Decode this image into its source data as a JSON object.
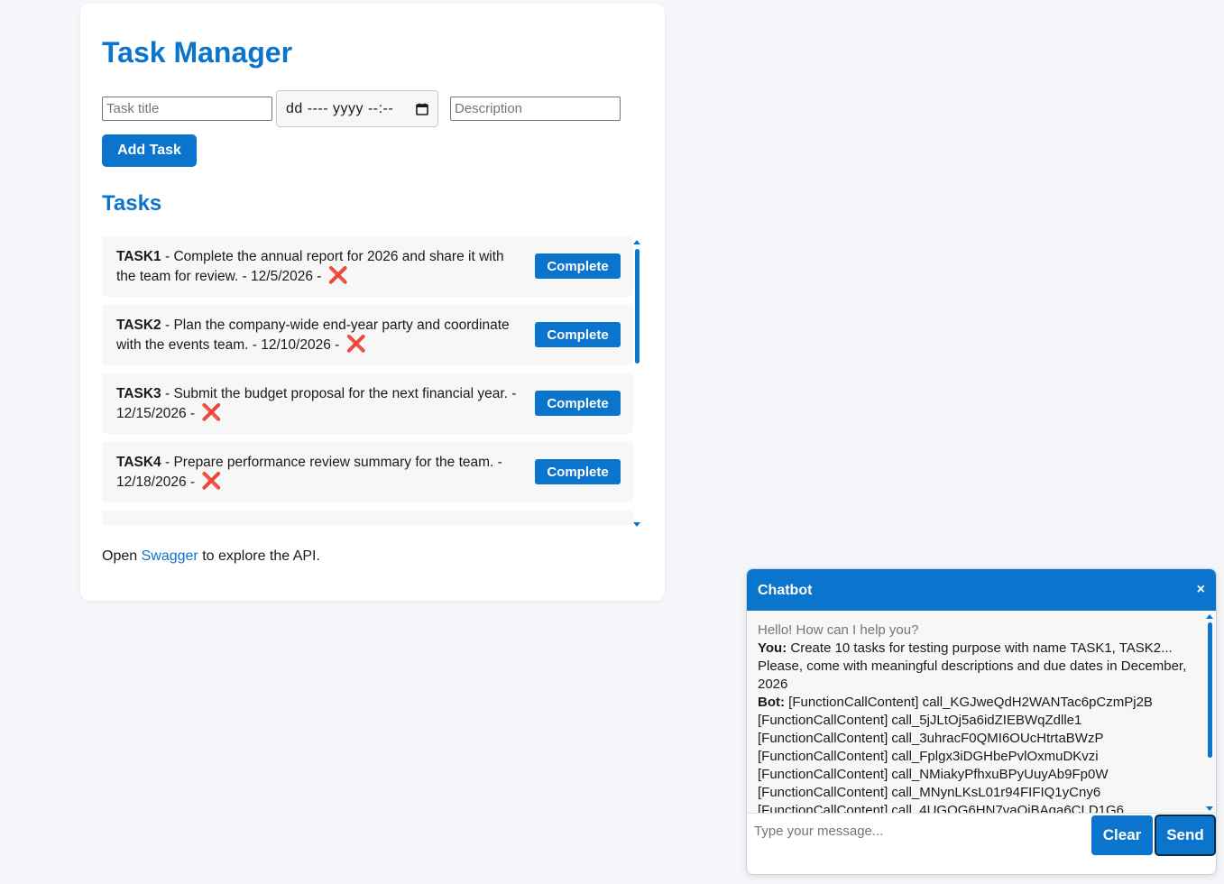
{
  "app": {
    "title": "Task Manager",
    "tasks_heading": "Tasks"
  },
  "form": {
    "title_placeholder": "Task title",
    "date_value": "dd ---- yyyy --:--",
    "description_placeholder": "Description",
    "add_button": "Add Task",
    "calendar_icon": "calendar-icon"
  },
  "tasks": [
    {
      "name": "TASK1",
      "line1": " - Complete the annual report for 2026 and share it with",
      "line2": "the team for review. - 12/5/2026 - ",
      "status_icon": "❌",
      "button": "Complete"
    },
    {
      "name": "TASK2",
      "line1": " - Plan the company-wide end-year party and coordinate",
      "line2": "with the events team. - 12/10/2026 - ",
      "status_icon": "❌",
      "button": "Complete"
    },
    {
      "name": "TASK3",
      "line1": " - Submit the budget proposal for the next financial year. -",
      "line2": "12/15/2026 - ",
      "status_icon": "❌",
      "button": "Complete"
    },
    {
      "name": "TASK4",
      "line1": " - Prepare performance review summary for the team. -",
      "line2": "12/18/2026 - ",
      "status_icon": "❌",
      "button": "Complete"
    }
  ],
  "footer": {
    "prefix": "Open ",
    "link": "Swagger",
    "suffix": " to explore the API."
  },
  "chatbot": {
    "title": "Chatbot",
    "close": "×",
    "greeting": "Hello! How can I help you?",
    "user_label": "You:",
    "user_message": " Create 10 tasks for testing purpose with name TASK1, TASK2... Please, come with meaningful descriptions and due dates in December, 2026",
    "bot_label": "Bot:",
    "bot_lines": [
      " [FunctionCallContent] call_KGJweQdH2WANTac6pCzmPj2B",
      "[FunctionCallContent] call_5jJLtOj5a6idZIEBWqZdlle1",
      "[FunctionCallContent] call_3uhracF0QMI6OUcHtrtaBWzP",
      "[FunctionCallContent] call_Fplgx3iDGHbePvlOxmuDKvzi",
      "[FunctionCallContent] call_NMiakyPfhxuBPyUuyAb9Fp0W",
      "[FunctionCallContent] call_MNynLKsL01r94FIFIQ1yCny6",
      "[FunctionCallContent] call_4UGOG6HN7vaQiBAqa6CLD1G6"
    ],
    "input_placeholder": "Type your message...",
    "clear_button": "Clear",
    "send_button": "Send"
  },
  "colors": {
    "accent": "#0b74cc",
    "background": "#f4f6f9",
    "delete_icon": "#e0406e"
  }
}
